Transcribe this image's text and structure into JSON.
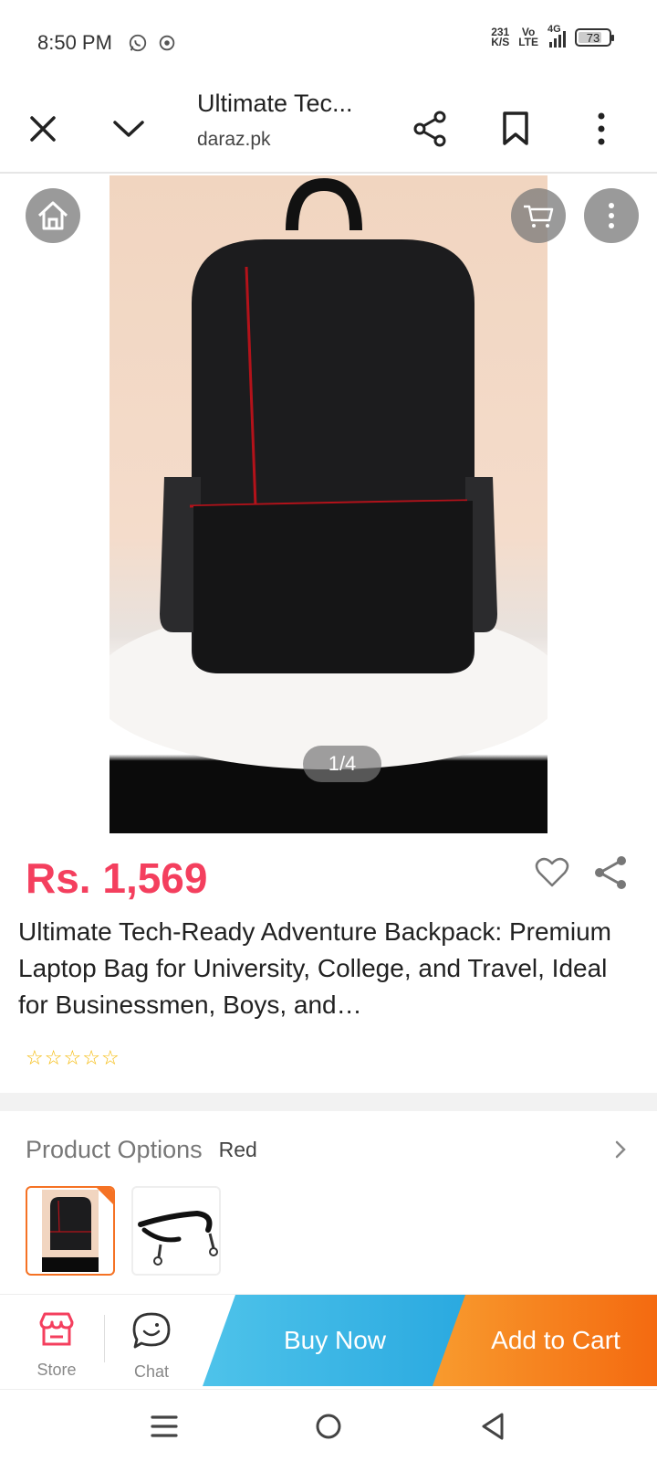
{
  "status_bar": {
    "time": "8:50 PM",
    "net_speed_value": "231",
    "net_speed_unit": "K/S",
    "volte_top": "Vo",
    "volte_bottom": "LTE",
    "network": "4G",
    "battery": "73",
    "icons": [
      "whatsapp-icon",
      "chrome-icon"
    ]
  },
  "tab_header": {
    "title": "Ultimate Tec...",
    "domain": "daraz.pk",
    "icons": [
      "close-icon",
      "chevron-down-icon",
      "share-icon",
      "bookmark-icon",
      "more-vert-icon"
    ]
  },
  "gallery": {
    "page_indicator": "1/4",
    "icons": [
      "home-icon",
      "cart-icon",
      "more-vert-icon"
    ]
  },
  "product": {
    "price": "Rs. 1,569",
    "title": "Ultimate Tech-Ready Adventure Backpack: Premium Laptop Bag for University, College, and Travel, Ideal for Businessmen, Boys, and…",
    "rating": 0,
    "rating_max": 5
  },
  "options": {
    "label": "Product Options",
    "selected_value": "Red",
    "thumbnails": [
      "backpack",
      "strap"
    ]
  },
  "action_bar": {
    "store_label": "Store",
    "chat_label": "Chat",
    "buy_now_label": "Buy Now",
    "add_to_cart_label": "Add to Cart"
  },
  "colors": {
    "price": "#f43f5e",
    "buy_now": "#2aa9e0",
    "add_to_cart": "#f46a10",
    "accent_orange": "#f57224",
    "star": "#f5b800"
  }
}
